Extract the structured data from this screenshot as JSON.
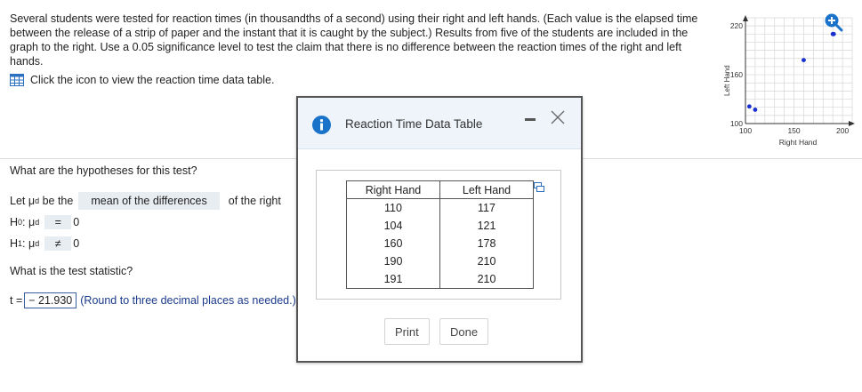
{
  "problem": {
    "text": "Several students were tested for reaction times (in thousandths of a second) using their right and left hands. (Each value is the elapsed time between the release of a strip of paper and the instant that it is caught by the subject.) Results from five of the students are included in the graph to the right. Use a 0.05 significance level to test the claim that there is no difference between the reaction times of the right and left hands.",
    "data_link_text": "Click the icon to view the reaction time data table."
  },
  "mini_chart": {
    "xlabel": "Right Hand",
    "ylabel": "Left Hand",
    "x_ticks": [
      "100",
      "150",
      "200"
    ],
    "y_ticks": [
      "100",
      "160",
      "220"
    ]
  },
  "chart_data": {
    "type": "scatter",
    "xlabel": "Right Hand",
    "ylabel": "Left Hand",
    "xlim": [
      100,
      210
    ],
    "ylim": [
      100,
      230
    ],
    "x": [
      110,
      104,
      160,
      190,
      191
    ],
    "y": [
      117,
      121,
      178,
      210,
      210
    ],
    "grid": true,
    "point_color": "#1a2fd0"
  },
  "hypotheses": {
    "question": "What are the hypotheses for this test?",
    "let_prefix": "Let",
    "let_suffix": "be the",
    "selected": "mean of the differences",
    "let_tail": "of the right",
    "h0": {
      "label": "H",
      "sub": "0",
      "param": ": μ",
      "param_sub": "d",
      "op": "=",
      "value": "0"
    },
    "h1": {
      "label": "H",
      "sub": "1",
      "param": ": μ",
      "param_sub": "d",
      "op": "≠",
      "value": "0"
    }
  },
  "test_stat": {
    "question": "What is the test statistic?",
    "prefix": "t =",
    "value": "− 21.930",
    "hint": "(Round to three decimal places as needed.)"
  },
  "modal": {
    "title": "Reaction Time Data Table",
    "columns": [
      "Right Hand",
      "Left Hand"
    ],
    "rows": [
      [
        "110",
        "117"
      ],
      [
        "104",
        "121"
      ],
      [
        "160",
        "178"
      ],
      [
        "190",
        "210"
      ],
      [
        "191",
        "210"
      ]
    ],
    "print_label": "Print",
    "done_label": "Done"
  },
  "colors": {
    "accent": "#1a73c9",
    "link": "#1a3a8a",
    "selection_bg": "#e8edf2"
  }
}
